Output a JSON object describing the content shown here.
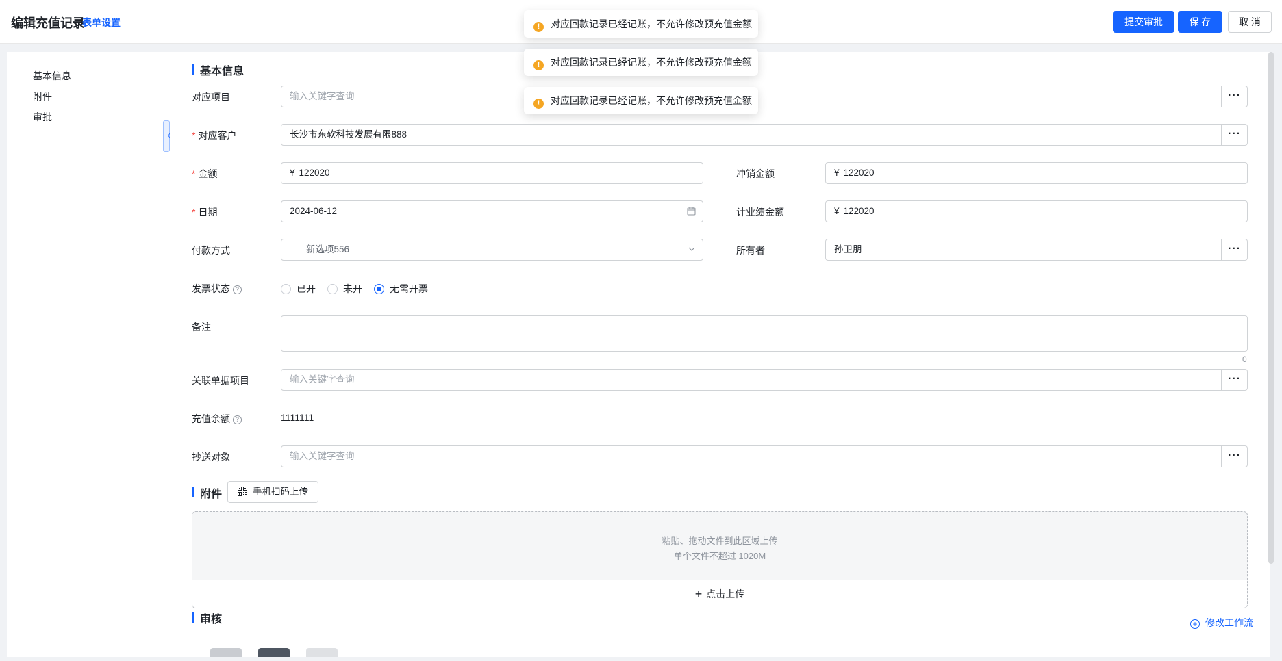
{
  "header": {
    "title": "编辑充值记录",
    "form_settings": "表单设置",
    "submit_label": "提交审批",
    "save_label": "保 存",
    "cancel_label": "取 消"
  },
  "sidebar": {
    "items": [
      {
        "label": "基本信息"
      },
      {
        "label": "附件"
      },
      {
        "label": "审批"
      }
    ]
  },
  "sections": {
    "basic": "基本信息",
    "attachments": "附件",
    "review": "审核"
  },
  "fields": {
    "project": {
      "label": "对应项目",
      "placeholder": "输入关键字查询"
    },
    "customer": {
      "label": "对应客户",
      "value": "长沙市东软科技发展有限888"
    },
    "amount": {
      "label": "金额",
      "prefix": "¥",
      "value": "122020"
    },
    "writeoff": {
      "label": "冲销金额",
      "prefix": "¥",
      "value": "122020"
    },
    "date": {
      "label": "日期",
      "value": "2024-06-12"
    },
    "performance": {
      "label": "计业绩金额",
      "prefix": "¥",
      "value": "122020"
    },
    "payment": {
      "label": "付款方式",
      "value": "新选项556"
    },
    "owner": {
      "label": "所有者",
      "value": "孙卫朋"
    },
    "invoice": {
      "label": "发票状态",
      "options": [
        "已开",
        "未开",
        "无需开票"
      ],
      "selected": "无需开票"
    },
    "remark": {
      "label": "备注",
      "count": "0"
    },
    "related": {
      "label": "关联单据项目",
      "placeholder": "输入关键字查询"
    },
    "balance": {
      "label": "充值余额",
      "value": "1111111"
    },
    "cc": {
      "label": "抄送对象",
      "placeholder": "输入关键字查询"
    }
  },
  "more_label": "···",
  "attachments": {
    "scan_label": "手机扫码上传",
    "drop_hint": "粘贴、拖动文件到此区域上传",
    "size_hint": "单个文件不超过 1020M",
    "upload_label": "点击上传"
  },
  "review": {
    "modify_workflow": "修改工作流"
  },
  "toasts": [
    {
      "text": "对应回款记录已经记账，不允许修改预充值金额"
    },
    {
      "text": "对应回款记录已经记账，不允许修改预充值金额"
    },
    {
      "text": "对应回款记录已经记账，不允许修改预充值金额"
    }
  ],
  "colors": {
    "primary": "#1664ff",
    "required": "#f54a45",
    "warning": "#f5a623"
  },
  "icons": {
    "more": "ellipsis-icon",
    "date": "calendar-icon",
    "select": "chevron-down-icon",
    "help": "question-circle-icon",
    "qr": "qrcode-icon",
    "upload": "plus-icon",
    "workflow": "plus-circle-icon",
    "toast": "warning-icon",
    "collapse": "chevron-left-icon"
  }
}
